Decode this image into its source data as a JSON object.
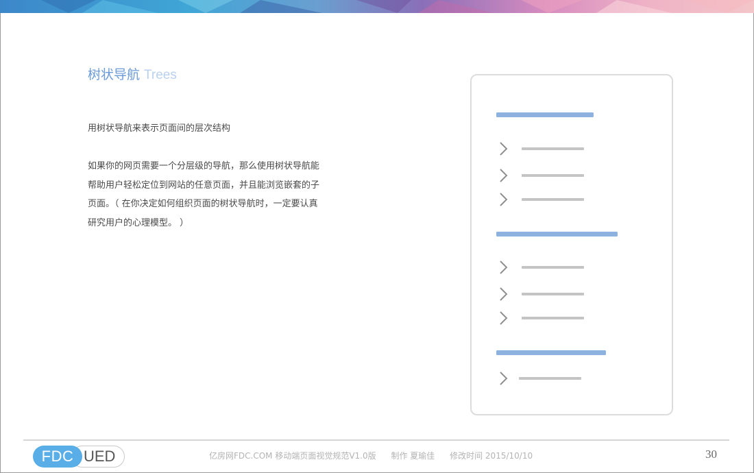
{
  "slide": {
    "title_zh": "树状导航",
    "title_en": "Trees",
    "lead": "用树状导航来表示页面间的层次结构",
    "paragraph_lines": [
      "如果你的网页需要一个分层级的导航，那么使用树状导航能",
      "帮助用户轻松定位到网站的任意页面，并且能浏览嵌套的子",
      "页面。（ 在你决定如何组织页面的树状导航时，一定要认真",
      "研究用户的心理模型。 ）"
    ]
  },
  "illustration": {
    "groups": [
      {
        "children": 3
      },
      {
        "children": 3
      },
      {
        "children": 1
      }
    ],
    "colors": {
      "header_bar": "#8db2e0",
      "item_bar": "#c4c4c4",
      "chevron": "#8f8f8f"
    }
  },
  "footer": {
    "logo_left": "FDC",
    "logo_right": "UED",
    "source": "亿房网FDC.COM 移动端页面视觉规范V1.0版",
    "author": "制作 夏瑜佳",
    "modified": "修改时间  2015/10/10",
    "page_number": "30"
  },
  "colors": {
    "accent": "#6b9bd8",
    "logo_blue": "#5aaee8"
  }
}
